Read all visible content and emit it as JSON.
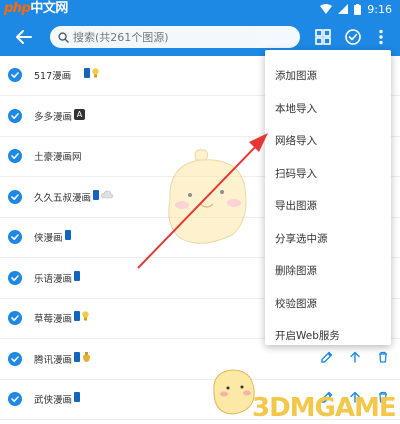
{
  "status_bar": {
    "time": "9:16",
    "watermark_php": "php",
    "watermark_rest": "中文网"
  },
  "search": {
    "placeholder": "搜索(共261个图源)"
  },
  "list": {
    "items": [
      {
        "name": "517漫画",
        "badges": [
          "phone",
          "bulb"
        ]
      },
      {
        "name": "多多漫画",
        "badges": [
          "A"
        ]
      },
      {
        "name": "土豪漫画网",
        "badges": []
      },
      {
        "name": "久久五叔漫画",
        "badges": [
          "phone",
          "cloud"
        ]
      },
      {
        "name": "侠漫画",
        "badges": [
          "phone"
        ]
      },
      {
        "name": "乐语漫画",
        "badges": [
          "phone"
        ]
      },
      {
        "name": "草莓漫画",
        "badges": [
          "phone",
          "bulb"
        ]
      },
      {
        "name": "腾讯漫画",
        "badges": [
          "phone",
          "bag"
        ]
      },
      {
        "name": "武侠漫画",
        "badges": [
          "phone"
        ]
      }
    ]
  },
  "menu": {
    "items": [
      "添加图源",
      "本地导入",
      "网络导入",
      "扫码导入",
      "导出图源",
      "分享选中源",
      "删除图源",
      "校验图源",
      "开启Web服务"
    ]
  },
  "badge_a": "A",
  "logo": {
    "text": "3DMGAME"
  },
  "colors": {
    "primary": "#1e88e5",
    "check": "#1e88e5",
    "arrow": "#e53935"
  },
  "icons": {
    "back": "arrow-back-icon",
    "grid": "grid-icon",
    "select_all": "check-circle-icon",
    "more": "more-vert-icon",
    "search": "search-icon",
    "edit": "edit-icon",
    "top": "to-top-icon",
    "delete": "delete-icon"
  }
}
